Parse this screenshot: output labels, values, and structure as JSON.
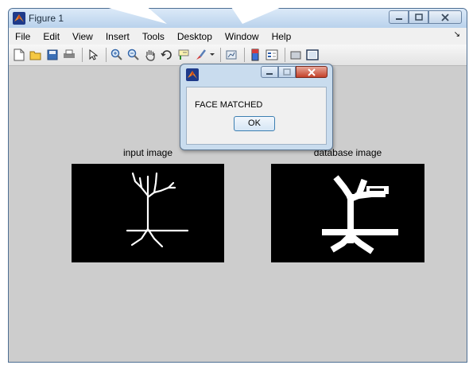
{
  "window": {
    "title": "Figure 1",
    "controls": [
      "minimize-icon",
      "maximize-icon",
      "close-icon"
    ]
  },
  "menu": {
    "items": [
      "File",
      "Edit",
      "View",
      "Insert",
      "Tools",
      "Desktop",
      "Window",
      "Help"
    ]
  },
  "toolbar": {
    "icons": [
      "new-figure-icon",
      "open-file-icon",
      "save-icon",
      "print-icon",
      "pointer-icon",
      "zoom-in-icon",
      "zoom-out-icon",
      "pan-icon",
      "rotate-3d-icon",
      "data-cursor-icon",
      "brush-icon",
      "link-plot-icon",
      "colorbar-icon",
      "legend-icon",
      "hide-plot-tools-icon",
      "show-plot-tools-icon"
    ]
  },
  "axes": {
    "left_title": "input image",
    "right_title": "database image"
  },
  "dialog": {
    "message": "FACE MATCHED",
    "ok_label": "OK"
  }
}
